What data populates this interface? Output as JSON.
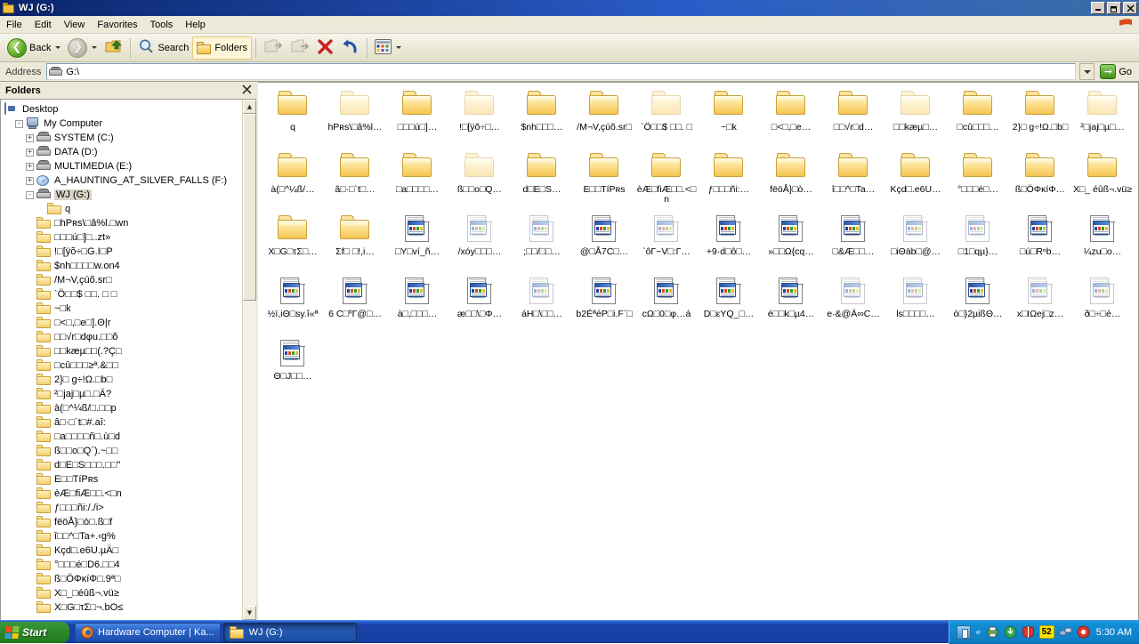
{
  "window": {
    "title": "WJ (G:)",
    "icon": "folder-icon",
    "buttons": {
      "minimize": "_",
      "restore": "❐",
      "close": "✕"
    }
  },
  "menu": {
    "items": [
      "File",
      "Edit",
      "View",
      "Favorites",
      "Tools",
      "Help"
    ]
  },
  "toolbar": {
    "back_label": "Back",
    "forward_label": "",
    "up_label": "",
    "search_label": "Search",
    "folders_label": "Folders",
    "move_to_label": "",
    "copy_to_label": "",
    "delete_label": "",
    "undo_label": "",
    "views_label": ""
  },
  "address": {
    "label": "Address",
    "value": "G:\\",
    "go_label": "Go"
  },
  "folders_pane": {
    "header": "Folders",
    "close": "✕",
    "tree": [
      {
        "label": "Desktop",
        "icon": "desktop-icon",
        "indent": 0,
        "plus": "",
        "selected": false
      },
      {
        "label": "My Computer",
        "icon": "my-computer-icon",
        "indent": 1,
        "plus": "-",
        "selected": false
      },
      {
        "label": "SYSTEM (C:)",
        "icon": "drive-icon",
        "indent": 2,
        "plus": "+",
        "selected": false
      },
      {
        "label": "DATA (D:)",
        "icon": "drive-icon",
        "indent": 2,
        "plus": "+",
        "selected": false
      },
      {
        "label": "MULTIMEDIA (E:)",
        "icon": "drive-icon",
        "indent": 2,
        "plus": "+",
        "selected": false
      },
      {
        "label": "A_HAUNTING_AT_SILVER_FALLS (F:)",
        "icon": "cd-drive-icon",
        "indent": 2,
        "plus": "+",
        "selected": false
      },
      {
        "label": "WJ (G:)",
        "icon": "drive-icon",
        "indent": 2,
        "plus": "-",
        "selected": true
      },
      {
        "label": "q",
        "icon": "folder-icon",
        "indent": 4,
        "plus": "",
        "selected": false
      },
      {
        "label": "□hPʀs\\□â%l.□wn",
        "icon": "folder-icon",
        "indent": 3,
        "plus": "",
        "selected": false
      },
      {
        "label": "□□□ú□]□..zt»",
        "icon": "folder-icon",
        "indent": 3,
        "plus": "",
        "selected": false
      },
      {
        "label": "!□[ÿõ÷□G.I□P",
        "icon": "folder-icon",
        "indent": 3,
        "plus": "",
        "selected": false
      },
      {
        "label": "$nh□□□□w.on4",
        "icon": "folder-icon",
        "indent": 3,
        "plus": "",
        "selected": false
      },
      {
        "label": "/M¬V,çúõ.sr□",
        "icon": "folder-icon",
        "indent": 3,
        "plus": "",
        "selected": false
      },
      {
        "label": "ˋÖ□□$ □□. □ □",
        "icon": "folder-icon",
        "indent": 3,
        "plus": "",
        "selected": false
      },
      {
        "label": "~□k",
        "icon": "folder-icon",
        "indent": 3,
        "plus": "",
        "selected": false
      },
      {
        "label": "□<□,□e□].Θ|r",
        "icon": "folder-icon",
        "indent": 3,
        "plus": "",
        "selected": false
      },
      {
        "label": "□□√r□dφu.□□õ",
        "icon": "folder-icon",
        "indent": 3,
        "plus": "",
        "selected": false
      },
      {
        "label": "□□kæµ□□(.?Ç□",
        "icon": "folder-icon",
        "indent": 3,
        "plus": "",
        "selected": false
      },
      {
        "label": "□cû□□□≥ª.&□□",
        "icon": "folder-icon",
        "indent": 3,
        "plus": "",
        "selected": false
      },
      {
        "label": "2}□ g÷!Ω.□b□",
        "icon": "folder-icon",
        "indent": 3,
        "plus": "",
        "selected": false
      },
      {
        "label": "²□jaj□µ□.□Ä?",
        "icon": "folder-icon",
        "indent": 3,
        "plus": "",
        "selected": false
      },
      {
        "label": "à(□^¼ß/□.□□p",
        "icon": "folder-icon",
        "indent": 3,
        "plus": "",
        "selected": false
      },
      {
        "label": "â□·□ˋt□#.aî:",
        "icon": "folder-icon",
        "indent": 3,
        "plus": "",
        "selected": false
      },
      {
        "label": "□a□□□□ñ□.ù□d",
        "icon": "folder-icon",
        "indent": 3,
        "plus": "",
        "selected": false
      },
      {
        "label": "ß□□o□Qˋ).~□□",
        "icon": "folder-icon",
        "indent": 3,
        "plus": "",
        "selected": false
      },
      {
        "label": "d□E□S□□□.□□\"",
        "icon": "folder-icon",
        "indent": 3,
        "plus": "",
        "selected": false
      },
      {
        "label": "E□□TíPʀs",
        "icon": "folder-icon",
        "indent": 3,
        "plus": "",
        "selected": false
      },
      {
        "label": "èÆ□fiÆ□□.<□n",
        "icon": "folder-icon",
        "indent": 3,
        "plus": "",
        "selected": false
      },
      {
        "label": "ƒ□□□ñi:/./i>",
        "icon": "folder-icon",
        "indent": 3,
        "plus": "",
        "selected": false
      },
      {
        "label": "fëöÅ}□ò□.ß□f",
        "icon": "folder-icon",
        "indent": 3,
        "plus": "",
        "selected": false
      },
      {
        "label": "î□□^□Ta+.‹g%",
        "icon": "folder-icon",
        "indent": 3,
        "plus": "",
        "selected": false
      },
      {
        "label": "Kçd□.e6U.µÄ□",
        "icon": "folder-icon",
        "indent": 3,
        "plus": "",
        "selected": false
      },
      {
        "label": "°□□□é□D6.□□4",
        "icon": "folder-icon",
        "indent": 3,
        "plus": "",
        "selected": false
      },
      {
        "label": "ß□ÖΦκíΦ□.9ª□",
        "icon": "folder-icon",
        "indent": 3,
        "plus": "",
        "selected": false
      },
      {
        "label": "X□_□éûß¬.vü≥",
        "icon": "folder-icon",
        "indent": 3,
        "plus": "",
        "selected": false
      },
      {
        "label": "X□G□τΣ□¬.bO≤",
        "icon": "folder-icon",
        "indent": 3,
        "plus": "",
        "selected": false
      }
    ]
  },
  "content": {
    "items": [
      {
        "name": "q",
        "type": "folder",
        "ghost": false
      },
      {
        "name": "hPʀs\\□â%l…",
        "type": "folder",
        "ghost": true
      },
      {
        "name": "□□□ú□]…",
        "type": "folder",
        "ghost": false
      },
      {
        "name": "!□[ÿõ÷□…",
        "type": "folder",
        "ghost": true
      },
      {
        "name": "$nh□□□…",
        "type": "folder",
        "ghost": false
      },
      {
        "name": "/M¬V,çúõ.sr□",
        "type": "folder",
        "ghost": false
      },
      {
        "name": "ˋÖ□□$ □□. □",
        "type": "folder",
        "ghost": true
      },
      {
        "name": "~□k",
        "type": "folder",
        "ghost": false
      },
      {
        "name": "□<□,□e…",
        "type": "folder",
        "ghost": false
      },
      {
        "name": "□□√r□d…",
        "type": "folder",
        "ghost": false
      },
      {
        "name": "□□kæµ□…",
        "type": "folder",
        "ghost": true
      },
      {
        "name": "□cû□□□…",
        "type": "folder",
        "ghost": false
      },
      {
        "name": "2}□ g÷!Ω.□b□",
        "type": "folder",
        "ghost": false
      },
      {
        "name": "²□jaj□µ□…",
        "type": "folder",
        "ghost": true
      },
      {
        "name": "à(□^¼ß/…",
        "type": "folder",
        "ghost": false
      },
      {
        "name": "â□·□ˋt□…",
        "type": "folder",
        "ghost": false
      },
      {
        "name": "□a□□□□…",
        "type": "folder",
        "ghost": false
      },
      {
        "name": "ß□□o□Q…",
        "type": "folder",
        "ghost": true
      },
      {
        "name": "d□E□S…",
        "type": "folder",
        "ghost": false
      },
      {
        "name": "E□□TíPʀs",
        "type": "folder",
        "ghost": false
      },
      {
        "name": "èÆ□fiÆ□□.<□n",
        "type": "folder",
        "ghost": false
      },
      {
        "name": "ƒ□□□ñi:…",
        "type": "folder",
        "ghost": false
      },
      {
        "name": "fëöÅ}□ò…",
        "type": "folder",
        "ghost": false
      },
      {
        "name": "î□□^□Ta…",
        "type": "folder",
        "ghost": false
      },
      {
        "name": "Kçd□.e6U…",
        "type": "folder",
        "ghost": false
      },
      {
        "name": "°□□□é□…",
        "type": "folder",
        "ghost": false
      },
      {
        "name": "ß□ÖΦκíΦ…",
        "type": "folder",
        "ghost": false
      },
      {
        "name": "X□_ éûß¬.vü≥",
        "type": "folder",
        "ghost": false
      },
      {
        "name": "X□G□τΣ□…",
        "type": "folder",
        "ghost": false
      },
      {
        "name": "Σf□ □!,i…",
        "type": "folder",
        "ghost": false
      },
      {
        "name": "□Y□ví_ñ…",
        "type": "file",
        "ghost": false
      },
      {
        "name": "/xóy□□□…",
        "type": "file",
        "ghost": true
      },
      {
        "name": ";□□/□□…",
        "type": "file",
        "ghost": true
      },
      {
        "name": "@□Å7C□…",
        "type": "file",
        "ghost": false
      },
      {
        "name": "ˋôΓ~V□:Γ…",
        "type": "file",
        "ghost": true
      },
      {
        "name": "+9·d□ô□…",
        "type": "file",
        "ghost": false
      },
      {
        "name": "»□□Ω{cq…",
        "type": "file",
        "ghost": false
      },
      {
        "name": "□&Æ□□…",
        "type": "file",
        "ghost": false
      },
      {
        "name": "□iΘäb□@…",
        "type": "file",
        "ghost": true
      },
      {
        "name": "□1□qµ}…",
        "type": "file",
        "ghost": true
      },
      {
        "name": "□ú□Rⁿb…",
        "type": "file",
        "ghost": false
      },
      {
        "name": "¼zu□o…",
        "type": "file",
        "ghost": false
      },
      {
        "name": "½ï,iΘ□sy.î«ª",
        "type": "file",
        "ghost": false
      },
      {
        "name": "6 C□ºΓ@□…",
        "type": "file",
        "ghost": false
      },
      {
        "name": "à□,□□□…",
        "type": "file",
        "ghost": false
      },
      {
        "name": "æ□□\\□Φ…",
        "type": "file",
        "ghost": false
      },
      {
        "name": "áH□\\□□…",
        "type": "file",
        "ghost": true
      },
      {
        "name": "b2ÉªéP□i.Fˊ□",
        "type": "file",
        "ghost": false
      },
      {
        "name": "cΩ□0□φ…á",
        "type": "file",
        "ghost": false
      },
      {
        "name": "D□εYQ_□…",
        "type": "file",
        "ghost": false
      },
      {
        "name": "é□□k□µ4…",
        "type": "file",
        "ghost": false
      },
      {
        "name": "e·&@Ä∞C…",
        "type": "file",
        "ghost": true
      },
      {
        "name": "ls□□□□…",
        "type": "file",
        "ghost": true
      },
      {
        "name": "ò□}2µißΘ…",
        "type": "file",
        "ghost": false
      },
      {
        "name": "x□IΩej□z…",
        "type": "file",
        "ghost": true
      },
      {
        "name": "ð□÷□è…",
        "type": "file",
        "ghost": true
      },
      {
        "name": "Θ□J□□…",
        "type": "file",
        "ghost": false
      }
    ]
  },
  "taskbar": {
    "start_label": "Start",
    "tasks": [
      {
        "label": "Hardware Computer | Ka...",
        "icon": "firefox-icon",
        "active": false
      },
      {
        "label": "WJ (G:)",
        "icon": "folder-icon",
        "active": true
      }
    ],
    "tray": {
      "expand": "«",
      "badge": "52",
      "time": "5:30 AM"
    }
  }
}
